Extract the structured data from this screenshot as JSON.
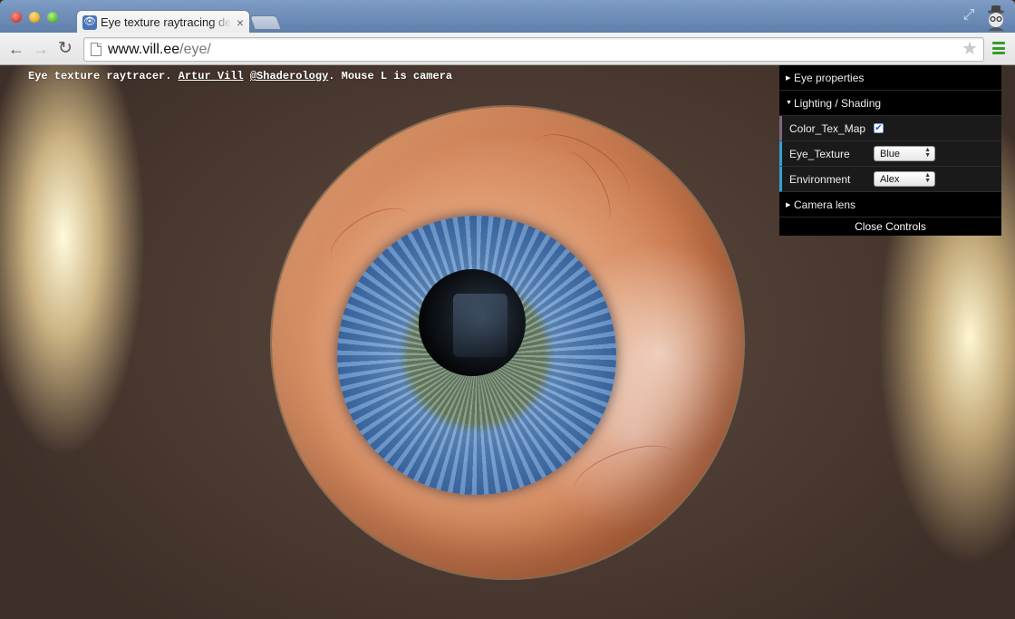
{
  "browser": {
    "tab_title": "Eye texture raytracing demo",
    "tab_close": "×",
    "favicon_glyph": "👁",
    "url_host": "www.vill.ee",
    "url_path": "/eye/",
    "back_glyph": "←",
    "forward_glyph": "→",
    "reload_glyph": "↻",
    "star_glyph": "★",
    "fullscreen_glyph": "⤢",
    "menu_color": "#3a9a2b"
  },
  "page": {
    "intro": "Eye texture raytracer. ",
    "author_link": "Artur Vill",
    "sep": " ",
    "twitter_link": "@Shaderology",
    "tail": ". Mouse L is camera"
  },
  "gui": {
    "folders": {
      "eye_properties": "Eye properties",
      "lighting_shading": "Lighting / Shading",
      "camera_lens": "Camera lens"
    },
    "collapsed_glyph": "▶",
    "expanded_glyph": "▼",
    "color_tex_map": {
      "label": "Color_Tex_Map",
      "checked": true,
      "check_glyph": "✔"
    },
    "eye_texture": {
      "label": "Eye_Texture",
      "value": "Blue"
    },
    "environment": {
      "label": "Environment",
      "value": "Alex"
    },
    "select_arrows": "▲▼",
    "close_label": "Close Controls"
  }
}
